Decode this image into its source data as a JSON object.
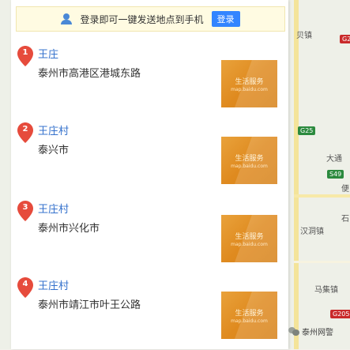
{
  "login_bar": {
    "message": "登录即可一键发送地点到手机",
    "button_label": "登录"
  },
  "results": [
    {
      "index": "1",
      "name": "王庄",
      "address": "泰州市高港区港城东路",
      "thumb_title": "生活服务",
      "thumb_sub": "map.baidu.com"
    },
    {
      "index": "2",
      "name": "王庄村",
      "address": "泰兴市",
      "thumb_title": "生活服务",
      "thumb_sub": "map.baidu.com"
    },
    {
      "index": "3",
      "name": "王庄村",
      "address": "泰州市兴化市",
      "thumb_title": "生活服务",
      "thumb_sub": "map.baidu.com"
    },
    {
      "index": "4",
      "name": "王庄村",
      "address": "泰州市靖江市叶王公路",
      "thumb_title": "生活服务",
      "thumb_sub": "map.baidu.com"
    }
  ],
  "map": {
    "labels": [
      "贝镇",
      "大通",
      "汉洞镇",
      "马集镇",
      "便",
      "石"
    ],
    "road_signs": [
      "G25",
      "S49",
      "G2",
      "G205"
    ]
  },
  "watermark": "泰州网警",
  "colors": {
    "pin": "#e64b3c",
    "link": "#3370cc",
    "login_button": "#3385ff",
    "thumb": "#df8a1f"
  }
}
